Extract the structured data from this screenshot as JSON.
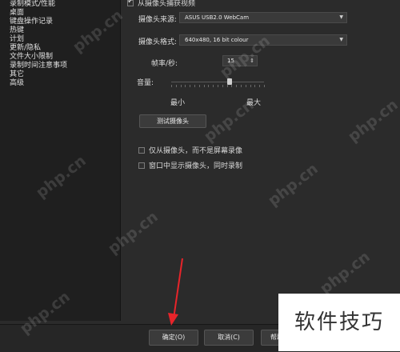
{
  "sidebar": {
    "items": [
      {
        "label": "录制模式/性能"
      },
      {
        "label": "桌面"
      },
      {
        "label": "键盘操作记录"
      },
      {
        "label": "热键"
      },
      {
        "label": "计划"
      },
      {
        "label": "更新/隐私"
      },
      {
        "label": "文件大小限制"
      },
      {
        "label": "录制时间注意事项"
      },
      {
        "label": "其它"
      },
      {
        "label": "高级"
      }
    ]
  },
  "panel": {
    "record_from_camera_label": "从摄像头捕获视频",
    "camera_source_label": "摄像头来源:",
    "camera_source_value": "ASUS USB2.0 WebCam",
    "camera_format_label": "摄像头格式:",
    "camera_format_value": "640x480, 16 bit colour",
    "fps_label": "帧率/秒:",
    "fps_value": "15",
    "volume_label": "音量:",
    "slider_min_label": "最小",
    "slider_max_label": "最大",
    "slider_level": 0.64,
    "test_camera_button": "测试摄像头",
    "option_camera_only_label": "仅从摄像头，而不是屏幕录像",
    "option_show_window_label": "窗口中显示摄像头，同时录制"
  },
  "footer": {
    "ok_button": "确定(O)",
    "cancel_button": "取消(C)",
    "help_button": "帮助"
  },
  "watermark": {
    "text": "php.cn",
    "brand_text": "软件技巧"
  },
  "colors": {
    "background": "#2b2b2b",
    "sidebar": "#1f1f1f",
    "arrow": "#e8242a"
  }
}
